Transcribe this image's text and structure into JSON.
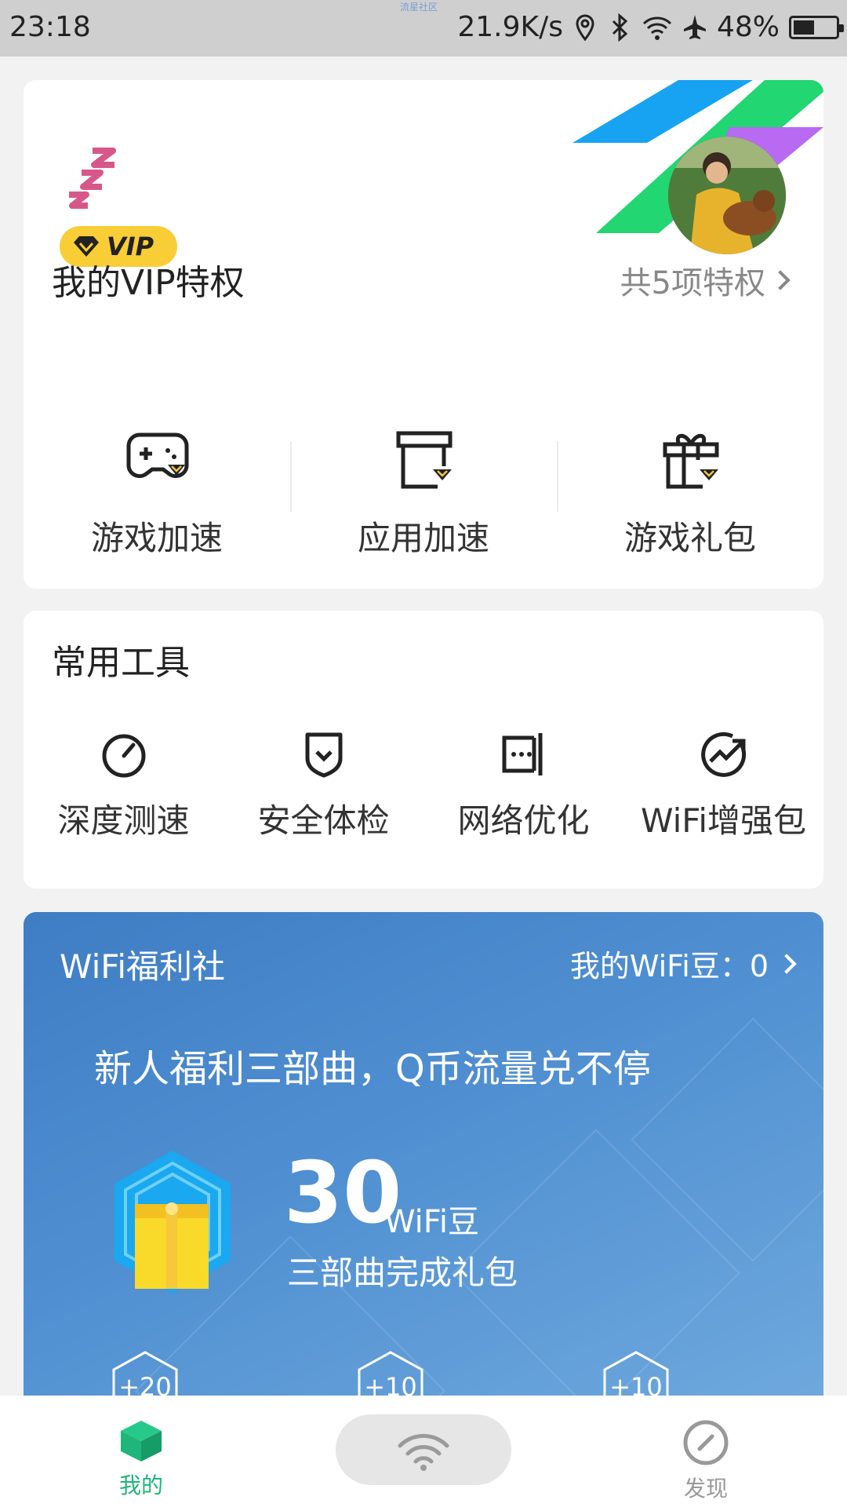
{
  "status_bar": {
    "time": "23:18",
    "watermark": "流星社区",
    "net_speed": "21.9K/s",
    "battery": "48%",
    "icons": [
      "location-icon",
      "bluetooth-icon",
      "wifi-icon",
      "airplane-icon",
      "battery-icon"
    ]
  },
  "vip_card": {
    "badge": "VIP",
    "section_title": "我的VIP特权",
    "privilege_count": "共5项特权",
    "items": [
      {
        "label": "游戏加速",
        "icon": "gamepad-icon"
      },
      {
        "label": "应用加速",
        "icon": "box-icon"
      },
      {
        "label": "游戏礼包",
        "icon": "gift-icon"
      }
    ]
  },
  "tools_card": {
    "section_title": "常用工具",
    "items": [
      {
        "label": "深度测速",
        "icon": "speedometer-icon"
      },
      {
        "label": "安全体检",
        "icon": "shield-icon"
      },
      {
        "label": "网络优化",
        "icon": "network-optimize-icon"
      },
      {
        "label": "WiFi增强包",
        "icon": "trend-up-icon"
      }
    ]
  },
  "welfare": {
    "title": "WiFi福利社",
    "my_beans": "我的WiFi豆：0",
    "headline": "新人福利三部曲，Q币流量兑不停",
    "amount": "30",
    "unit": "WiFi豆",
    "subtitle": "三部曲完成礼包",
    "steps": [
      "+20",
      "+10",
      "+10"
    ]
  },
  "bottom_nav": {
    "mine": "我的",
    "discover": "发现",
    "active_color": "#1fb679"
  }
}
